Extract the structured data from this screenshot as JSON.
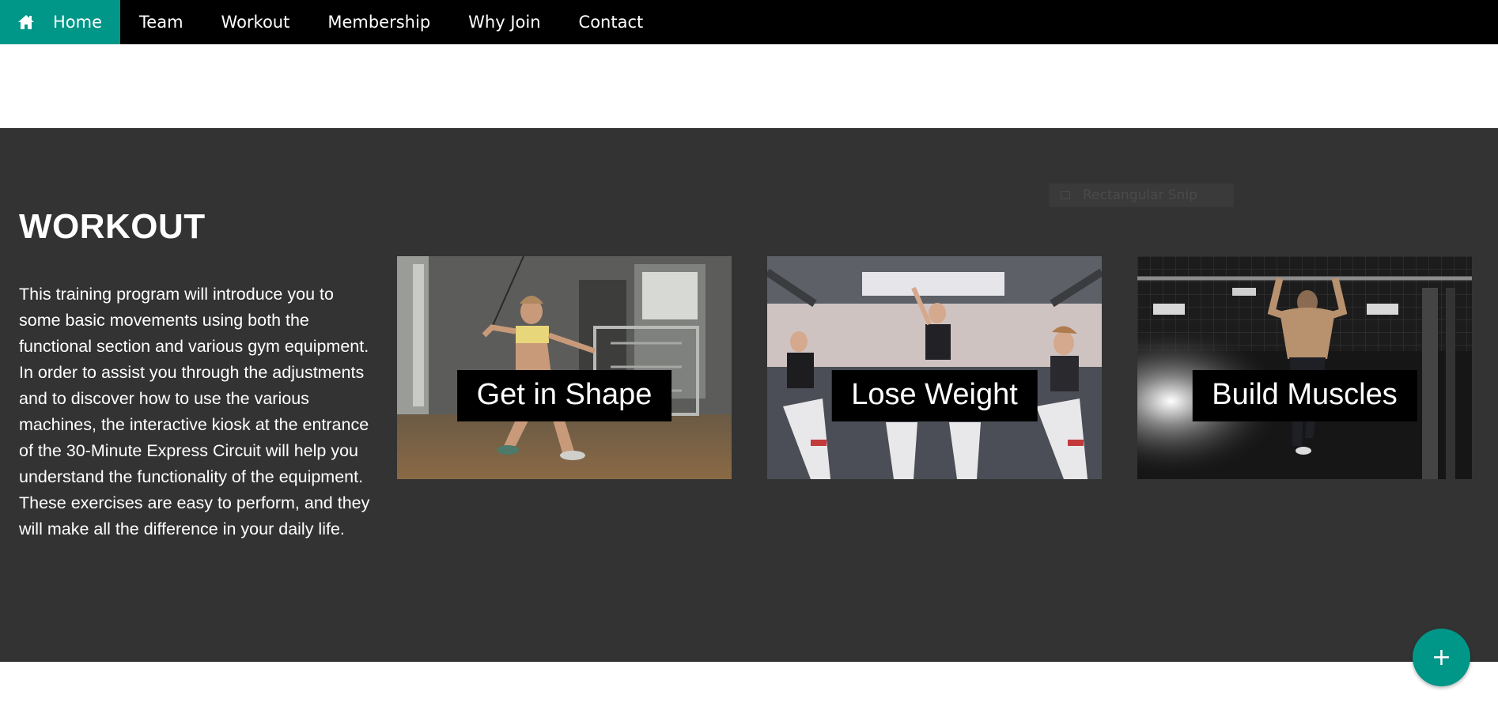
{
  "nav": {
    "items": [
      {
        "label": "Home",
        "icon": "home-icon",
        "active": true
      },
      {
        "label": "Team"
      },
      {
        "label": "Workout"
      },
      {
        "label": "Membership"
      },
      {
        "label": "Why Join"
      },
      {
        "label": "Contact"
      }
    ],
    "active_color": "#009688"
  },
  "workout": {
    "title": "WORKOUT",
    "description": "This training program will introduce you to some basic movements using both the functional section and various gym equipment. In order to assist you through the adjustments and to discover how to use the various machines, the interactive kiosk at the entrance of the 30-Minute Express Circuit will help you understand the functionality of the equipment. These exercises are easy to perform, and they will make all the difference in your daily life.",
    "cards": [
      {
        "label": "Get in Shape"
      },
      {
        "label": "Lose Weight"
      },
      {
        "label": "Build Muscles"
      }
    ]
  },
  "snip_ghost": {
    "label": "Rectangular Snip"
  },
  "fab": {
    "label": "+",
    "color": "#009688"
  }
}
